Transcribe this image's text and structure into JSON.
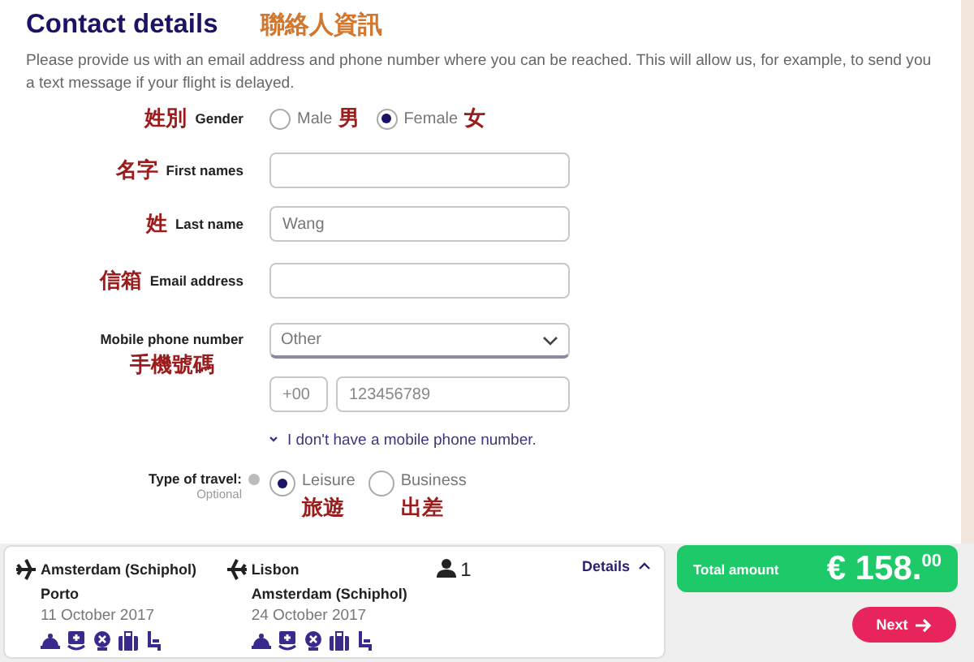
{
  "header": {
    "title": "Contact details",
    "annotation": "聯絡人資訊",
    "description": "Please provide us with an email address and phone number where you can be reached. This will allow us, for example, to send you a text message if your flight is delayed."
  },
  "form": {
    "gender": {
      "annotation": "姓別",
      "label": "Gender",
      "options": [
        {
          "label": "Male",
          "annotation": "男",
          "selected": false
        },
        {
          "label": "Female",
          "annotation": "女",
          "selected": true
        }
      ]
    },
    "fields": [
      {
        "annotation": "名字",
        "label": "First names"
      },
      {
        "annotation": "姓",
        "label": "Last name",
        "value": "Wang"
      },
      {
        "annotation": "信箱",
        "label": "Email address"
      }
    ],
    "mobile": {
      "label": "Mobile phone number",
      "annotation": "手機號碼",
      "country": "Other",
      "prefix_placeholder": "+00",
      "number_placeholder": "123456789",
      "no_mobile_link": "I don't have a mobile phone number."
    },
    "travel": {
      "label": "Type of travel:",
      "hint": "Optional",
      "options": [
        {
          "label": "Leisure",
          "annotation": "旅遊",
          "selected": true
        },
        {
          "label": "Business",
          "annotation": "出差",
          "selected": false
        }
      ]
    }
  },
  "booking": {
    "trips": [
      {
        "kind": "outbound",
        "from": "Amsterdam (Schiphol)",
        "to": "Porto",
        "date": "11 October 2017"
      },
      {
        "kind": "return",
        "from": "Lisbon",
        "to": "Amsterdam (Schiphol)",
        "date": "24 October 2017"
      }
    ],
    "passengers": "1",
    "details": "Details",
    "total_label": "Total amount",
    "total": "€ 158.$^{00}$",
    "next": "Next"
  }
}
